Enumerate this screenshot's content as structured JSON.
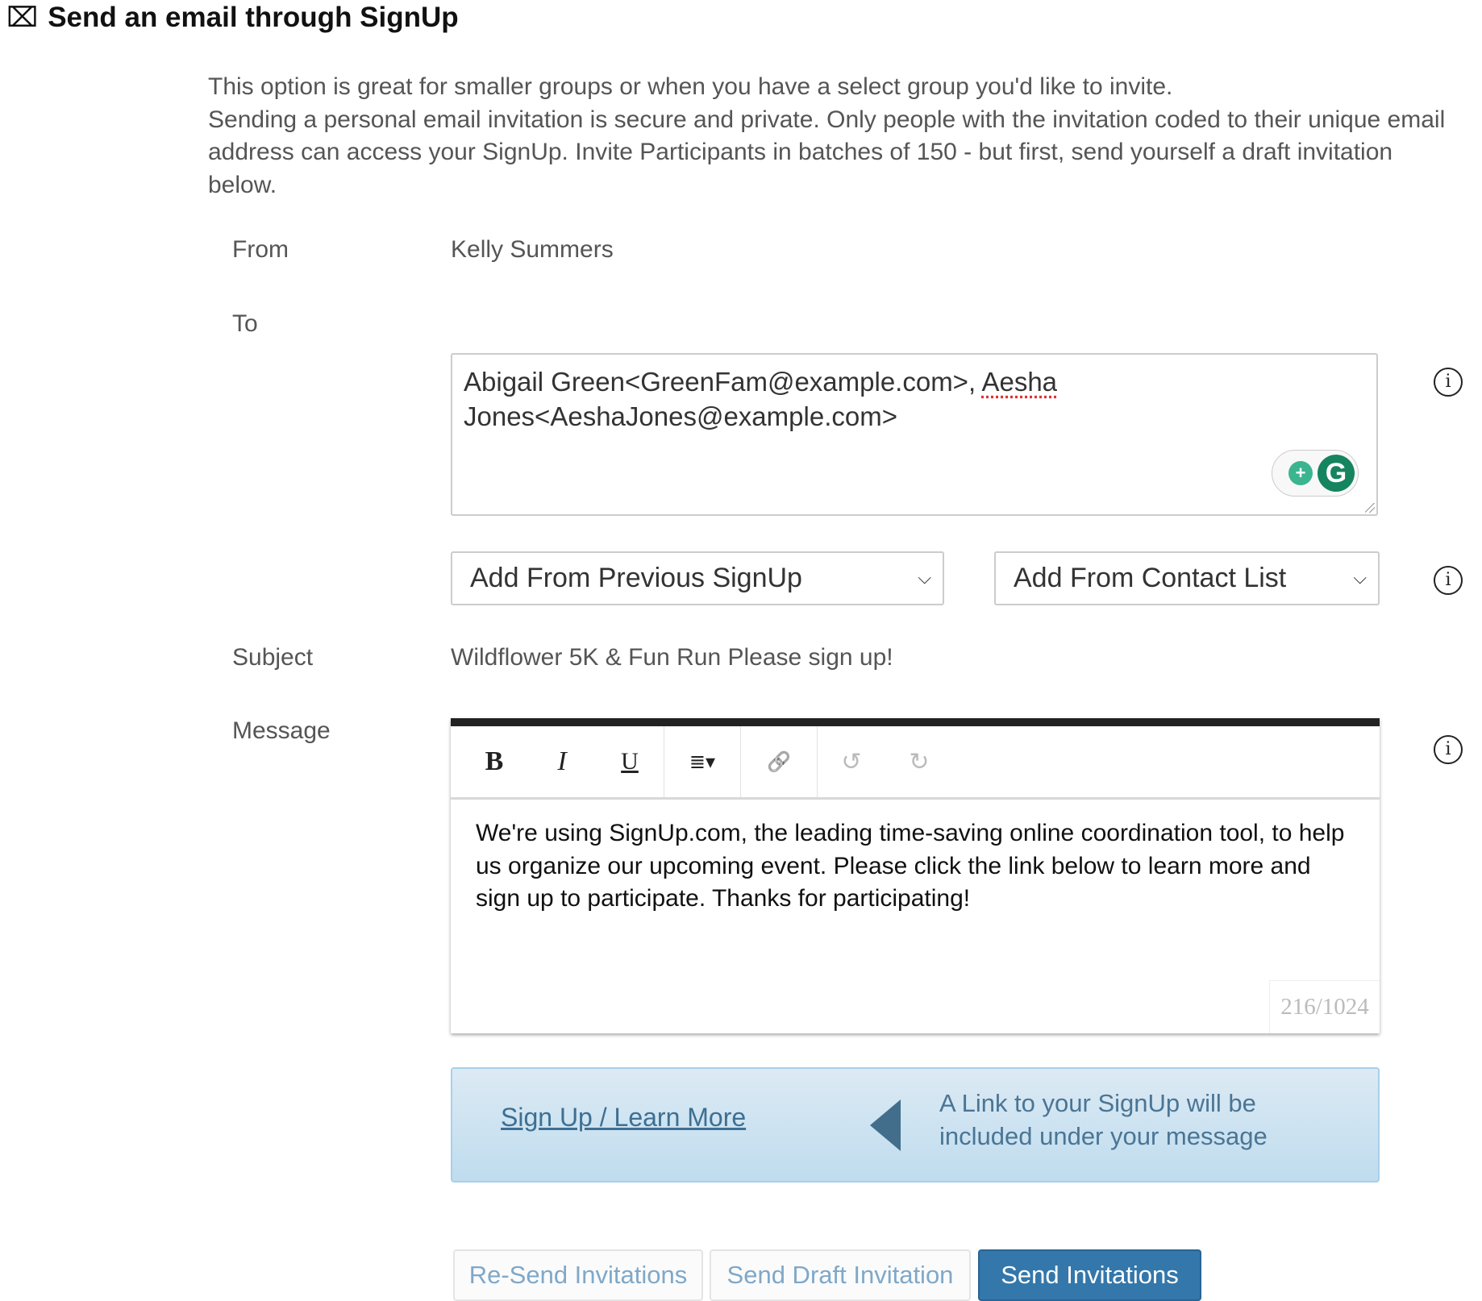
{
  "header": {
    "icon": "envelope-icon",
    "title": "Send an email through SignUp"
  },
  "intro": {
    "line1": "This option is great for smaller groups or when you have a select group you'd like to invite.",
    "line2": "Sending a personal email invitation is secure and private. Only people with the invitation coded to their unique email address can access your SignUp. Invite Participants in batches of 150 - but first, send yourself a draft invitation below."
  },
  "form": {
    "from_label": "From",
    "from_value": "Kelly Summers",
    "to_label": "To",
    "to_value_part1": "Abigail Green<GreenFam@example.com>, ",
    "to_value_misspelled": "Aesha",
    "to_value_part2": " Jones<AeshaJones@example.com>",
    "previous_signup_select": "Add From Previous SignUp",
    "contact_list_select": "Add From Contact List",
    "subject_label": "Subject",
    "subject_value": "Wildflower 5K & Fun Run Please sign up!",
    "message_label": "Message",
    "message_body": "We're using SignUp.com, the leading time-saving online coordination tool, to help us organize our upcoming event. Please click the link below to learn more and sign up to participate. Thanks for participating!",
    "char_counter": "216/1024"
  },
  "toolbar": {
    "bold": "B",
    "italic": "I",
    "underline": "U",
    "align": "≣▾",
    "link": "🔗",
    "undo": "↺",
    "redo": "↻"
  },
  "link_preview": {
    "link_text": "Sign Up / Learn More",
    "note": "A Link to your SignUp will be included under your message"
  },
  "buttons": {
    "resend": "Re-Send Invitations",
    "draft": "Send Draft Invitation",
    "send": "Send Invitations"
  },
  "colors": {
    "primary": "#3477aa",
    "link_box": "#cfe4f2",
    "link_text": "#3d6f92"
  }
}
